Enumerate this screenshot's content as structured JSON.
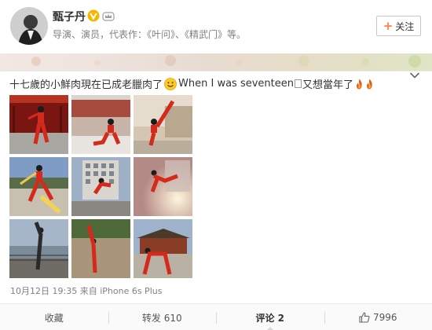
{
  "profile": {
    "name": "甄子丹",
    "bio": "导演、演员，代表作：《叶问》、《精武门》等。",
    "verified_color": "#f7b500",
    "follow_label": "关注",
    "follow_icon": "plus-icon",
    "accent": "#ff8140"
  },
  "post": {
    "text_part1": "十七歲的小鮮肉現在已成老臘肉了",
    "text_part2": "When I was seventeen",
    "text_part3": "又想當年了",
    "emoji": "smile-emoji",
    "images": [
      {
        "desc": "red-gate-kick",
        "bg": "#7a1612"
      },
      {
        "desc": "crane-stance-courtyard",
        "bg": "#c7a191"
      },
      {
        "desc": "high-kick-by-building",
        "bg": "#cfbfa8"
      },
      {
        "desc": "sword-pose-plaza",
        "bg": "#6f8fb8"
      },
      {
        "desc": "kick-by-modern-building",
        "bg": "#8a99ad"
      },
      {
        "desc": "flying-kick-glow",
        "bg": "#b48a86"
      },
      {
        "desc": "split-kick-lakeside",
        "bg": "#96a9bf"
      },
      {
        "desc": "standing-split-street",
        "bg": "#9a8c70"
      },
      {
        "desc": "kick-before-temple",
        "bg": "#8a5a3e"
      }
    ],
    "date": "10月12日 19:35",
    "source_prefix": "来自",
    "source": "iPhone 6s Plus"
  },
  "actions": {
    "favorite": "收藏",
    "repost": "转发 610",
    "comment": "评论 2",
    "like_count": "7996",
    "like_icon": "thumbs-up-icon"
  }
}
